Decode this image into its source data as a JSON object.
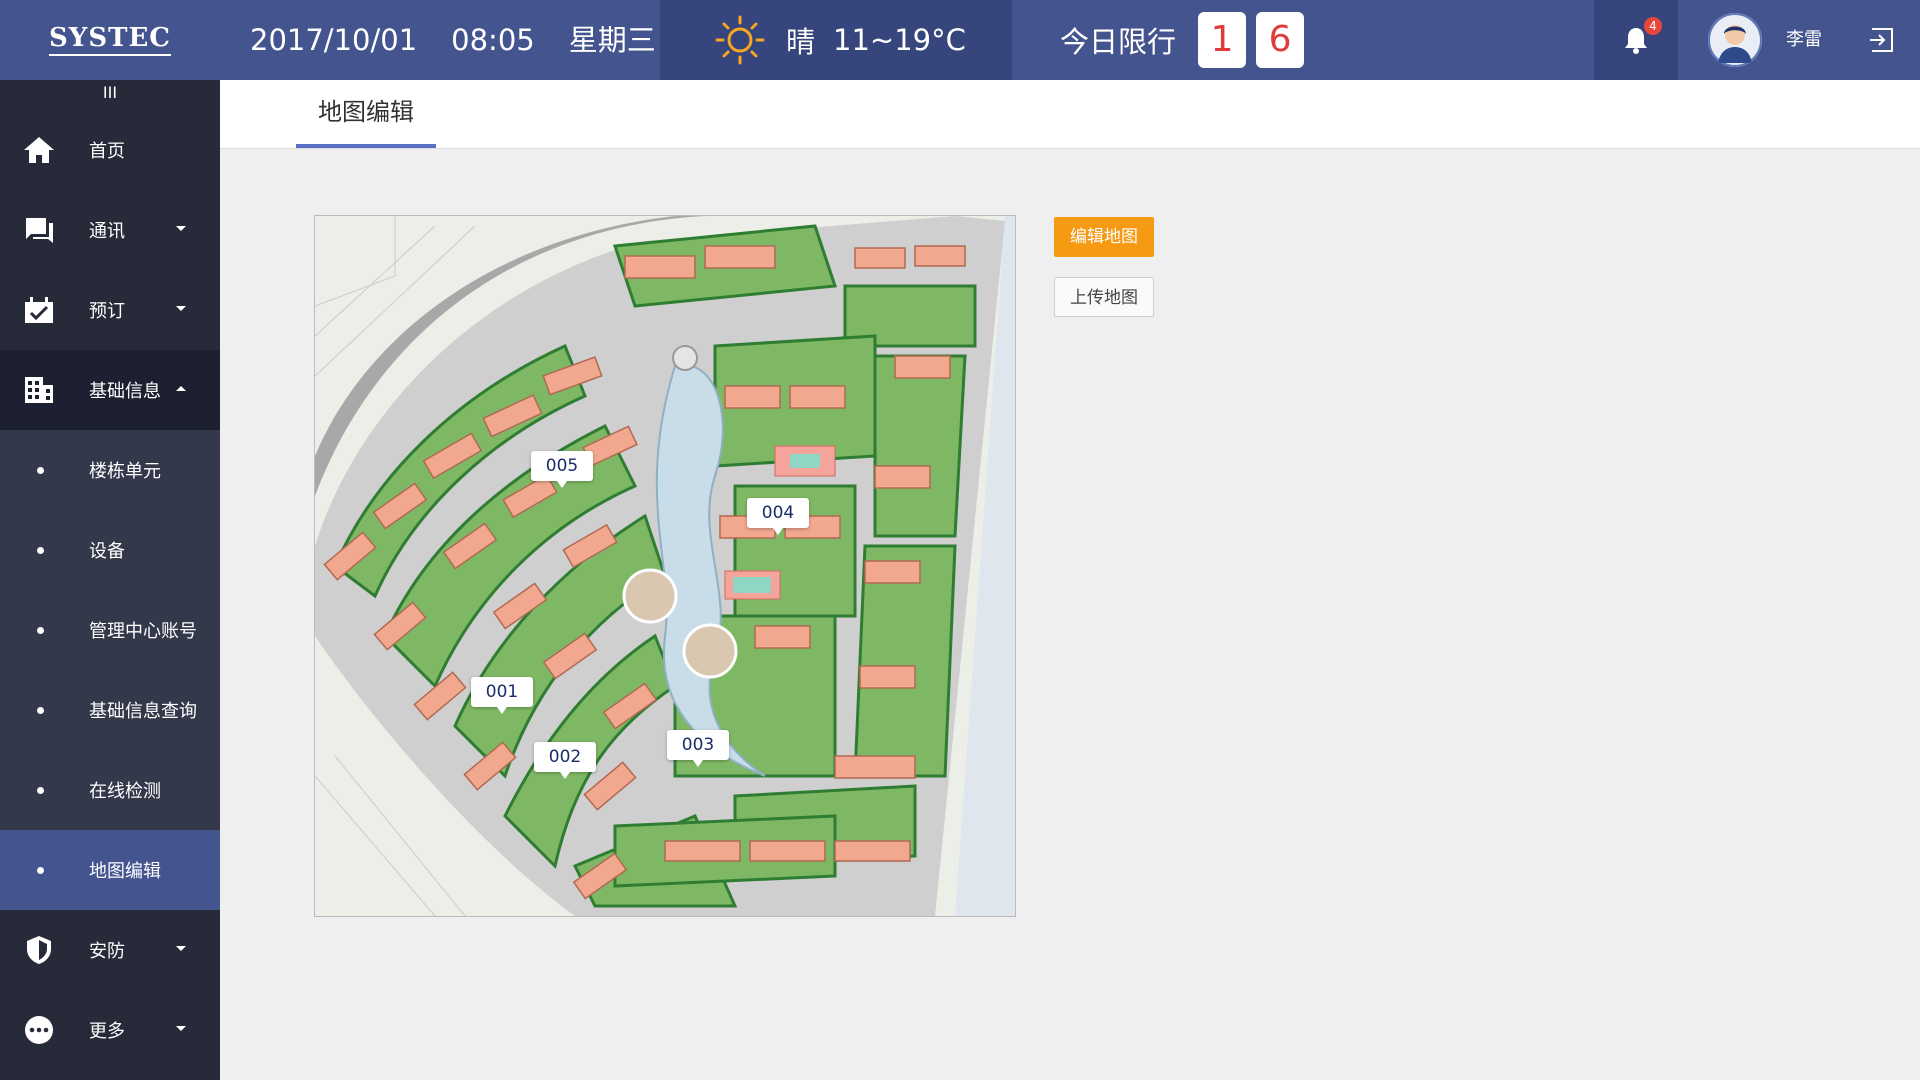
{
  "header": {
    "logo": "SYSTEC",
    "date": "2017/10/01",
    "time": "08:05",
    "weekday": "星期三",
    "weather": {
      "condition": "晴",
      "temp": "11~19°C",
      "icon": "sun-icon"
    },
    "traffic_limit": {
      "label": "今日限行",
      "numbers": [
        "1",
        "6"
      ]
    },
    "notifications": {
      "count": "4",
      "icon": "bell-icon"
    },
    "user": {
      "name": "李雷"
    },
    "logout_icon": "logout-icon"
  },
  "sidebar": {
    "collapse_symbol": "III",
    "items": [
      {
        "label": "首页",
        "icon": "home-icon"
      },
      {
        "label": "通讯",
        "icon": "chat-icon"
      },
      {
        "label": "预订",
        "icon": "booking-icon"
      },
      {
        "label": "基础信息",
        "icon": "building-icon"
      }
    ],
    "sub_items": [
      {
        "label": "楼栋单元"
      },
      {
        "label": "设备"
      },
      {
        "label": "管理中心账号"
      },
      {
        "label": "基础信息查询"
      },
      {
        "label": "在线检测"
      },
      {
        "label": "地图编辑"
      }
    ],
    "bottom_items": [
      {
        "label": "安防",
        "icon": "shield-icon"
      },
      {
        "label": "更多",
        "icon": "more-icon"
      }
    ]
  },
  "tabs": [
    {
      "label": "地图编辑"
    }
  ],
  "map": {
    "labels": [
      "005",
      "004",
      "001",
      "002",
      "003"
    ]
  },
  "actions": {
    "edit_map": "编辑地图",
    "upload_map": "上传地图"
  },
  "colors": {
    "header": "#44548f",
    "header_dark": "#36457c",
    "sidebar": "#262a39",
    "accent_orange": "#f59a12",
    "plate_red": "#e03a3a"
  }
}
